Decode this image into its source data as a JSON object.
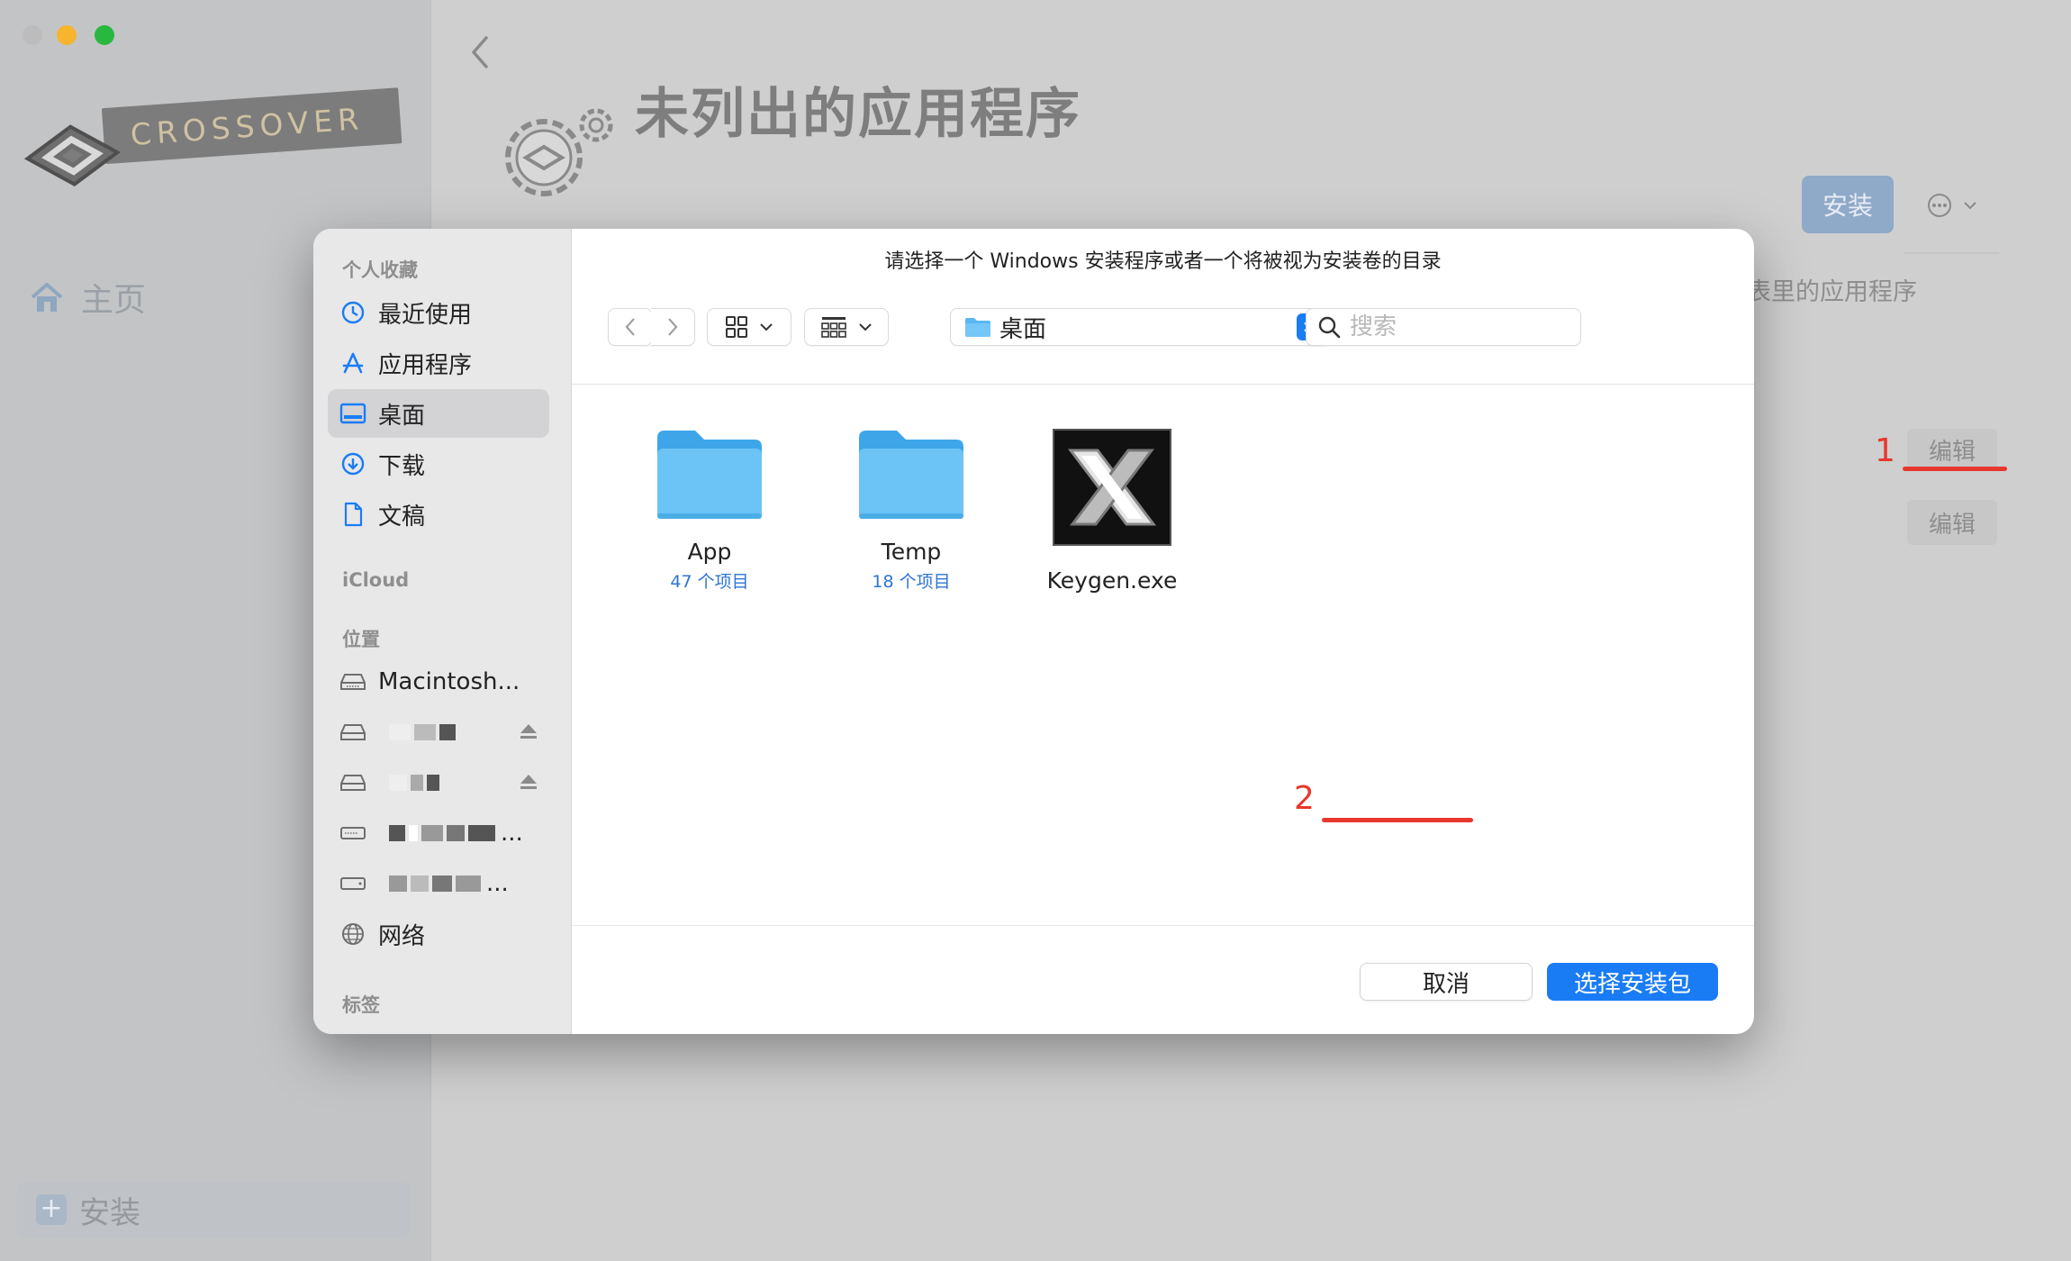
{
  "background_app": {
    "logo_text": "CROSSOVER",
    "home_label": "主页",
    "bottom_install_label": "安装",
    "page_title": "未列出的应用程序",
    "install_button": "安装",
    "right_snippet": "表里的应用程序",
    "edit_label_1": "编辑",
    "edit_label_2": "编辑",
    "annotation_1": "1"
  },
  "dialog": {
    "title": "请选择一个 Windows 安装程序或者一个将被视为安装卷的目录",
    "sidebar": {
      "favorites_header": "个人收藏",
      "favorites": [
        {
          "label": "最近使用",
          "icon": "clock-icon"
        },
        {
          "label": "应用程序",
          "icon": "apps-icon"
        },
        {
          "label": "桌面",
          "icon": "desktop-icon",
          "selected": true
        },
        {
          "label": "下载",
          "icon": "download-icon"
        },
        {
          "label": "文稿",
          "icon": "document-icon"
        }
      ],
      "icloud_header": "iCloud",
      "locations_header": "位置",
      "locations": [
        {
          "label": "Macintosh...",
          "icon": "disk-icon"
        },
        {
          "label": "",
          "icon": "external-disk-icon",
          "redacted": true
        },
        {
          "label": "",
          "icon": "external-disk-icon",
          "redacted": true
        },
        {
          "label": "...",
          "icon": "drive-icon",
          "redacted": true
        },
        {
          "label": "...",
          "icon": "drive-icon",
          "redacted": true
        },
        {
          "label": "网络",
          "icon": "globe-icon"
        }
      ],
      "tags_header": "标签"
    },
    "toolbar": {
      "location": "桌面",
      "search_placeholder": "搜索"
    },
    "files": [
      {
        "name": "App",
        "sub": "47 个项目",
        "type": "folder"
      },
      {
        "name": "Temp",
        "sub": "18 个项目",
        "type": "folder"
      },
      {
        "name": "Keygen.exe",
        "sub": "",
        "type": "exe"
      }
    ],
    "annotation_2": "2",
    "cancel_button": "取消",
    "choose_button": "选择安装包"
  },
  "colors": {
    "accent": "#1a7cf5",
    "annotation_red": "#e8372d",
    "folder_blue": "#6cc3f5"
  }
}
